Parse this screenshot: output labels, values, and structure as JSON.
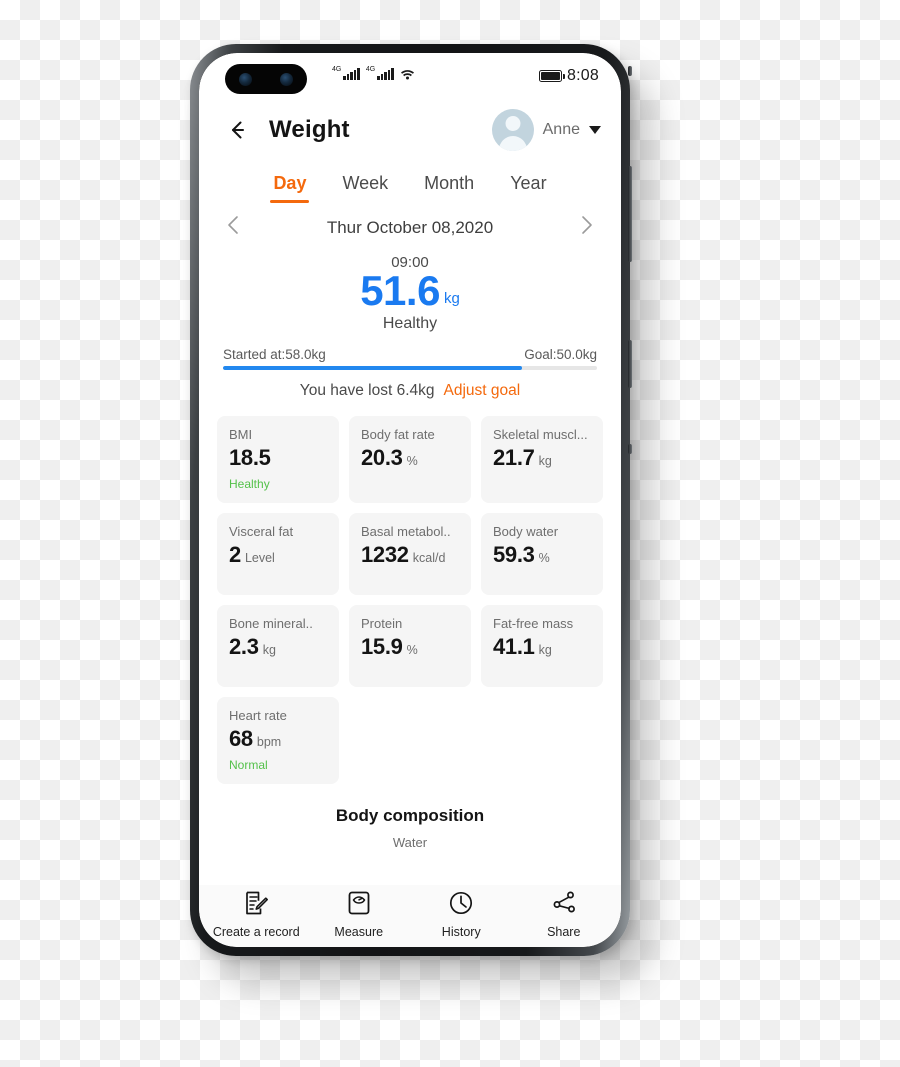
{
  "status_bar": {
    "network_1": "4G",
    "network_2": "4G",
    "wifi_icon": "wifi-icon",
    "battery_icon": "battery-full-icon",
    "time": "8:08"
  },
  "app_bar": {
    "back_icon": "back-arrow-icon",
    "title": "Weight",
    "avatar_icon": "user-avatar-icon",
    "profile_name": "Anne",
    "caret_icon": "chevron-down-icon"
  },
  "tabs": [
    {
      "label": "Day",
      "active": true
    },
    {
      "label": "Week",
      "active": false
    },
    {
      "label": "Month",
      "active": false
    },
    {
      "label": "Year",
      "active": false
    }
  ],
  "date_nav": {
    "prev_icon": "chevron-left-icon",
    "date": "Thur October 08,2020",
    "next_icon": "chevron-right-icon"
  },
  "weight": {
    "time": "09:00",
    "value": "51.6",
    "unit": "kg",
    "status": "Healthy"
  },
  "goal": {
    "started_label": "Started at:58.0kg",
    "goal_label": "Goal:50.0kg",
    "progress_percent": 80,
    "lost_text": "You have lost 6.4kg",
    "adjust_label": "Adjust goal"
  },
  "metrics": [
    {
      "label": "BMI",
      "value": "18.5",
      "unit": "",
      "note": "Healthy"
    },
    {
      "label": "Body fat rate",
      "value": "20.3",
      "unit": "%",
      "note": ""
    },
    {
      "label": "Skeletal muscl...",
      "value": "21.7",
      "unit": "kg",
      "note": ""
    },
    {
      "label": "Visceral fat",
      "value": "2",
      "unit": "Level",
      "note": ""
    },
    {
      "label": "Basal metabol..",
      "value": "1232",
      "unit": "kcal/d",
      "note": ""
    },
    {
      "label": "Body water",
      "value": "59.3",
      "unit": "%",
      "note": ""
    },
    {
      "label": "Bone mineral..",
      "value": "2.3",
      "unit": "kg",
      "note": ""
    },
    {
      "label": "Protein",
      "value": "15.9",
      "unit": "%",
      "note": ""
    },
    {
      "label": "Fat-free mass",
      "value": "41.1",
      "unit": "kg",
      "note": ""
    },
    {
      "label": "Heart rate",
      "value": "68",
      "unit": "bpm",
      "note": "Normal"
    }
  ],
  "body_composition": {
    "title": "Body composition",
    "first_item": "Water"
  },
  "bottom_nav": [
    {
      "label": "Create a record",
      "icon": "create-record-icon"
    },
    {
      "label": "Measure",
      "icon": "scale-icon"
    },
    {
      "label": "History",
      "icon": "clock-icon"
    },
    {
      "label": "Share",
      "icon": "share-icon"
    }
  ],
  "colors": {
    "accent": "#f4690d",
    "weight_blue": "#1a7af0",
    "progress_blue": "#2288ef",
    "healthy_green": "#54c14a",
    "card_bg": "#f5f5f5"
  }
}
